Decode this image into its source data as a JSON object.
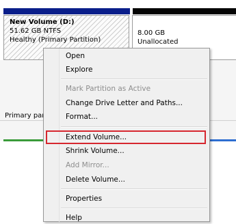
{
  "disk": {
    "volume_name": "New Volume  (D:)",
    "volume_size": "51.62 GB NTFS",
    "volume_status": "Healthy (Primary Partition)",
    "unalloc_size": "8.00 GB",
    "unalloc_label": "Unallocated",
    "legend_primary": "Primary par"
  },
  "menu": {
    "open": "Open",
    "explore": "Explore",
    "mark_active": "Mark Partition as Active",
    "change_letter": "Change Drive Letter and Paths...",
    "format": "Format...",
    "extend": "Extend Volume...",
    "shrink": "Shrink Volume...",
    "add_mirror": "Add Mirror...",
    "delete": "Delete Volume...",
    "properties": "Properties",
    "help": "Help"
  },
  "colors": {
    "highlight_border": "#d6262e",
    "primary_bar": "#0a1e8a",
    "unallocated_bar": "#050505"
  }
}
